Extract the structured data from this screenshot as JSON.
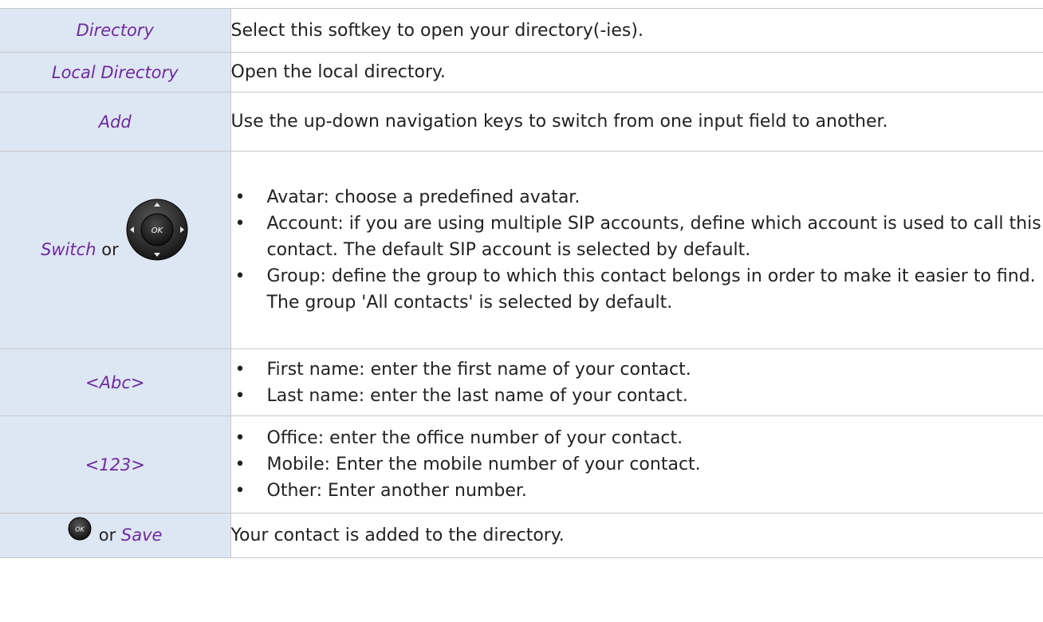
{
  "rows": [
    {
      "key": "Directory",
      "description": "Select this softkey to open your directory(-ies)."
    },
    {
      "key": "Local Directory",
      "description": "Open the local directory."
    },
    {
      "key": "Add",
      "description": "Use the up-down navigation keys to switch from one input field to another."
    },
    {
      "key": "Switch",
      "key_or": "or",
      "key_icon": "ok-navigation-keypad-icon",
      "button_text": "OK",
      "bullets": [
        "Avatar: choose a predefined avatar.",
        "Account: if you are using multiple SIP accounts, define which account is used to call this contact. The default SIP account is selected by default.",
        "Group: define the group to which this contact belongs in order to make it easier to find. The group 'All contacts' is selected by default."
      ]
    },
    {
      "key": "<Abc>",
      "bullets": [
        "First name: enter the first name of your contact.",
        "Last name: enter the last name of your contact."
      ]
    },
    {
      "key": "<123>",
      "bullets": [
        "Office: enter the office number of your contact.",
        "Mobile: Enter the mobile number of your contact.",
        "Other: Enter another number."
      ]
    },
    {
      "key_icon": "ok-button-icon",
      "button_text": "OK",
      "key_or": "or",
      "key": "Save",
      "description": "Your contact is added to the directory."
    }
  ]
}
